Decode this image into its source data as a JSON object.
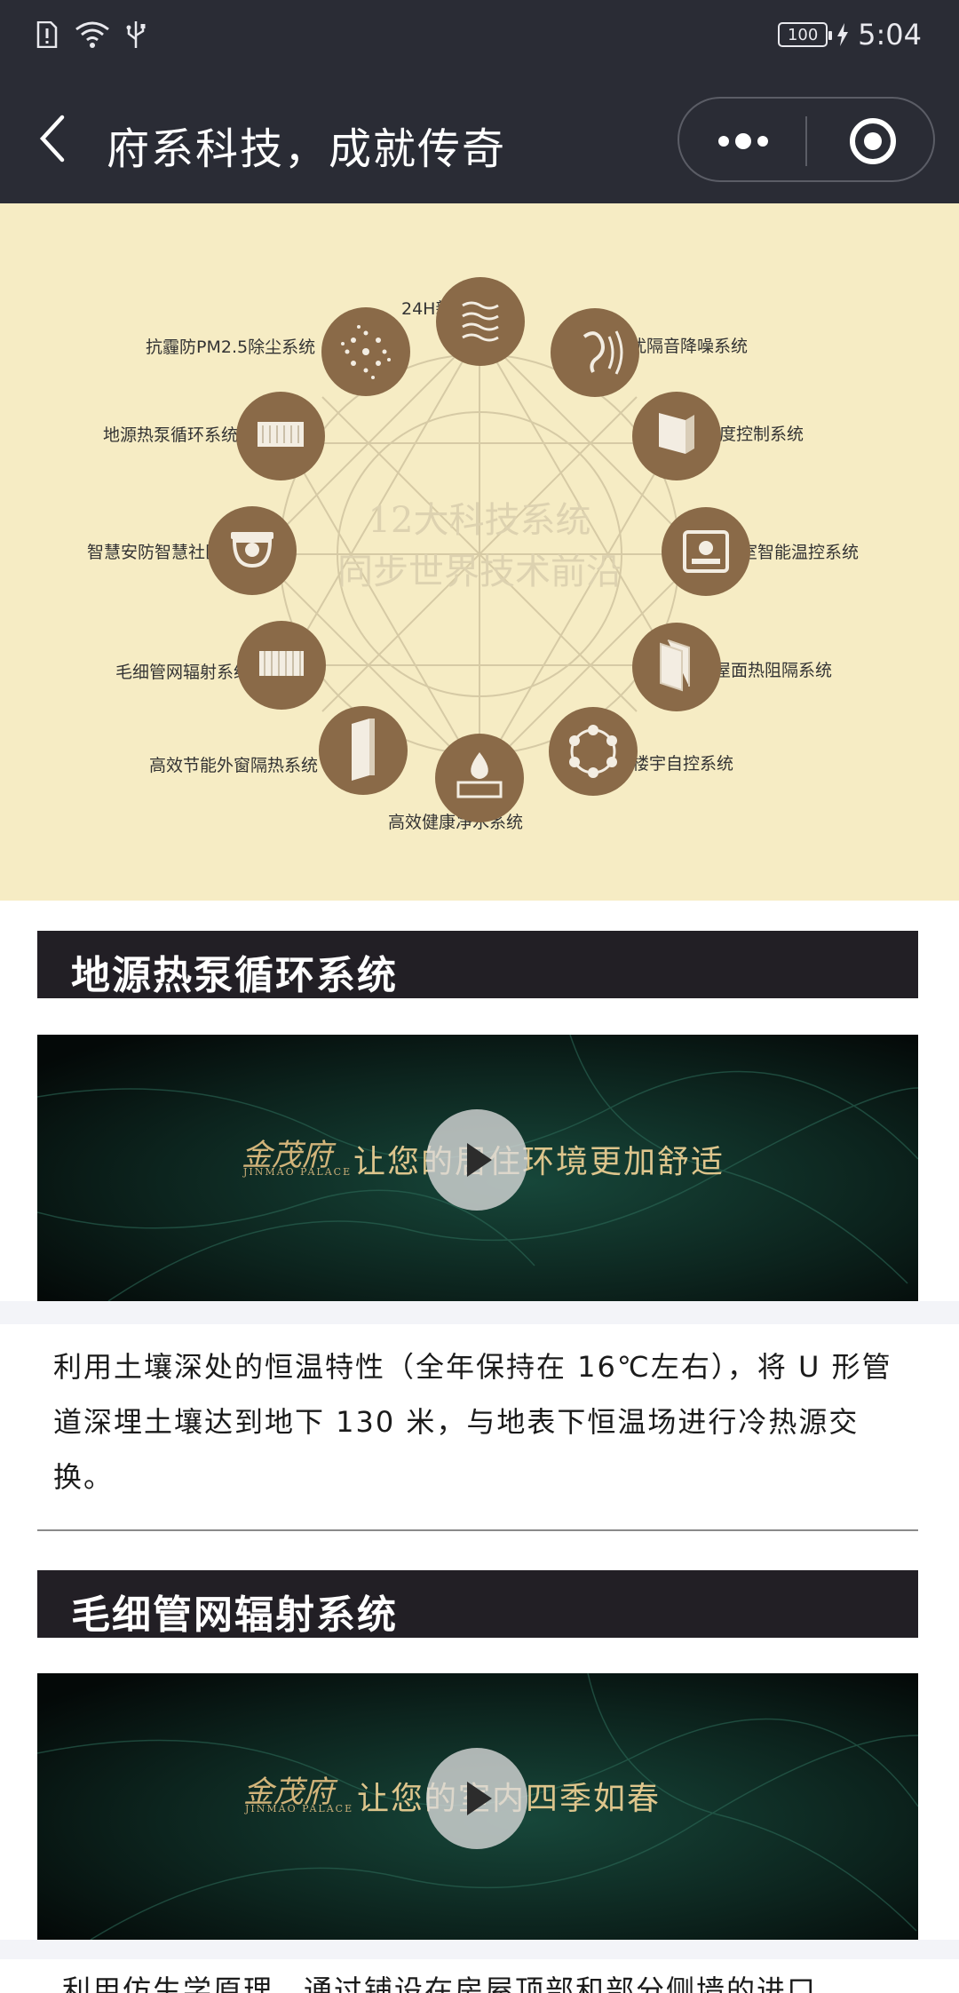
{
  "status_bar": {
    "time": "5:04",
    "battery_level": "100",
    "icons": [
      "alert-icon",
      "wifi-icon",
      "usb-icon",
      "charging-icon"
    ]
  },
  "navbar": {
    "title": "府系科技，成就传奇",
    "back_icon": "chevron-left-icon",
    "more_icon": "more-dots-icon",
    "close_icon": "target-circle-icon"
  },
  "hero": {
    "center_title_1": "12大科技系统",
    "center_title_2": "同步世界技术前沿",
    "systems": [
      {
        "label": "24H新风系统",
        "icon": "airflow-icon"
      },
      {
        "label": "干扰隔音降噪系统",
        "icon": "ear-sound-icon"
      },
      {
        "label": "恒湿度控制系统",
        "icon": "humidity-panel-icon"
      },
      {
        "label": "分室智能温控系统",
        "icon": "thermostat-icon"
      },
      {
        "label": "墙屋面热阻隔系统",
        "icon": "insulation-board-icon"
      },
      {
        "label": "楼宇自控系统",
        "icon": "network-ring-icon"
      },
      {
        "label": "高效健康净水系统",
        "icon": "water-drop-icon"
      },
      {
        "label": "高效节能外窗隔热系统",
        "icon": "window-frame-icon"
      },
      {
        "label": "毛细管网辐射系统",
        "icon": "capillary-mesh-icon"
      },
      {
        "label": "智慧安防智慧社区",
        "icon": "security-camera-icon"
      },
      {
        "label": "地源热泵循环系统",
        "icon": "heat-pump-icon"
      },
      {
        "label": "抗霾防PM2.5除尘系统",
        "icon": "dust-particles-icon"
      }
    ]
  },
  "sections": [
    {
      "title": "地源热泵循环系统",
      "video": {
        "logo_cn": "金茂府",
        "logo_en": "JINMAO PALACE",
        "caption": "让您的居住环境更加舒适",
        "play_icon": "play-icon"
      },
      "description": "利用土壤深处的恒温特性（全年保持在 16℃左右），将 U 形管道深埋土壤达到地下 130 米，与地表下恒温场进行冷热源交换。"
    },
    {
      "title": "毛细管网辐射系统",
      "video": {
        "logo_cn": "金茂府",
        "logo_en": "JINMAO PALACE",
        "caption": "让您的室内四季如春",
        "play_icon": "play-icon"
      },
      "description": "利用仿生学原理，通过铺设在房屋顶部和部分侧墙的进口"
    }
  ],
  "colors": {
    "bar_bg": "#2a2c35",
    "hero_bg": "#f6ecc4",
    "icon_brown": "#8a6a48",
    "header_bg": "#221f25",
    "gold_text": "#ddc58c"
  }
}
